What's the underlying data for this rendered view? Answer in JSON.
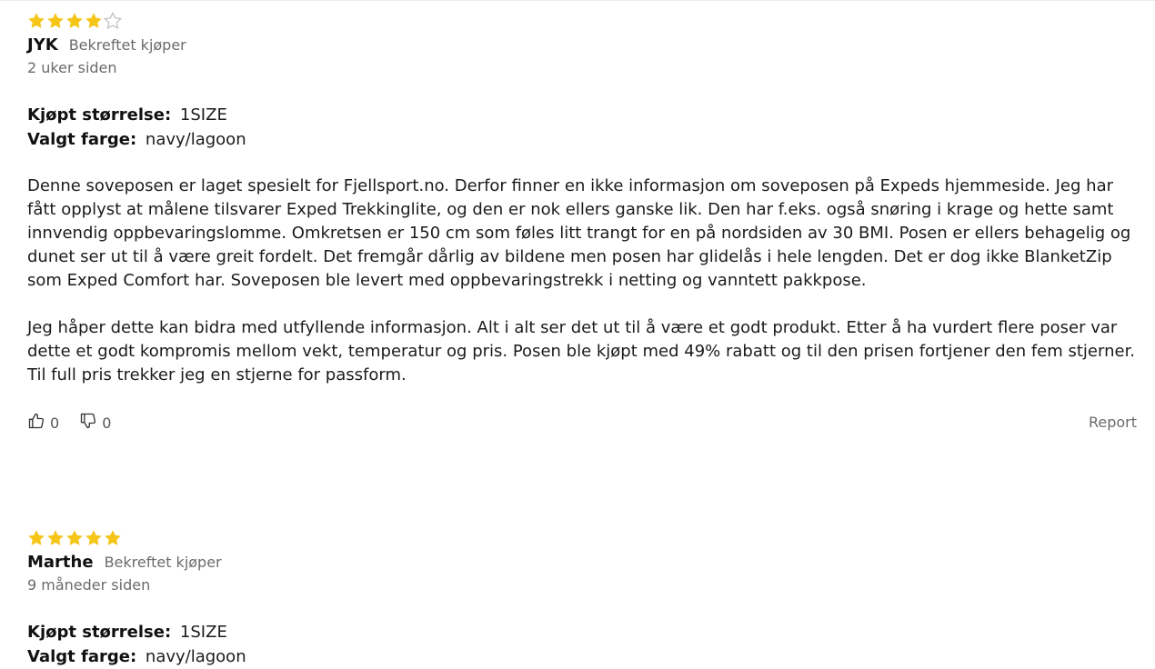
{
  "reviews": [
    {
      "rating": 4,
      "max_rating": 5,
      "author": "JYK",
      "verified_label": "Bekreftet kjøper",
      "date": "2 uker siden",
      "size_label": "Kjøpt størrelse:",
      "size_value": "1SIZE",
      "color_label": "Valgt farge:",
      "color_value": "navy/lagoon",
      "paragraphs": [
        "Denne soveposen er laget spesielt for Fjellsport.no. Derfor finner en ikke informasjon om soveposen på Expeds hjemmeside. Jeg har fått opplyst at målene tilsvarer Exped Trekkinglite, og den er nok ellers ganske lik. Den har f.eks. også snøring i krage og hette samt innvendig oppbevaringslomme. Omkretsen er 150 cm som føles litt trangt for en på nordsiden av 30 BMI. Posen er ellers behagelig og dunet ser ut til å være greit fordelt. Det fremgår dårlig av bildene men posen har glidelås i hele lengden. Det er dog ikke BlanketZip som Exped Comfort har. Soveposen ble levert med oppbevaringstrekk i netting og vanntett pakkpose.",
        "Jeg håper dette kan bidra med utfyllende informasjon. Alt i alt ser det ut til å være et godt produkt. Etter å ha vurdert flere poser var dette et godt kompromis mellom vekt, temperatur og pris. Posen ble kjøpt med 49% rabatt og til den prisen fortjener den fem stjerner. Til full pris trekker jeg en stjerne for passform."
      ],
      "helpful_count": "0",
      "unhelpful_count": "0",
      "report_label": "Report"
    },
    {
      "rating": 5,
      "max_rating": 5,
      "author": "Marthe",
      "verified_label": "Bekreftet kjøper",
      "date": "9 måneder siden",
      "size_label": "Kjøpt størrelse:",
      "size_value": "1SIZE",
      "color_label": "Valgt farge:",
      "color_value": "navy/lagoon"
    }
  ],
  "icons": {
    "star_filled_color": "#f5c518",
    "star_empty_color": "#bdbdbd",
    "thumbs_up": "thumbs-up-icon",
    "thumbs_down": "thumbs-down-icon"
  }
}
